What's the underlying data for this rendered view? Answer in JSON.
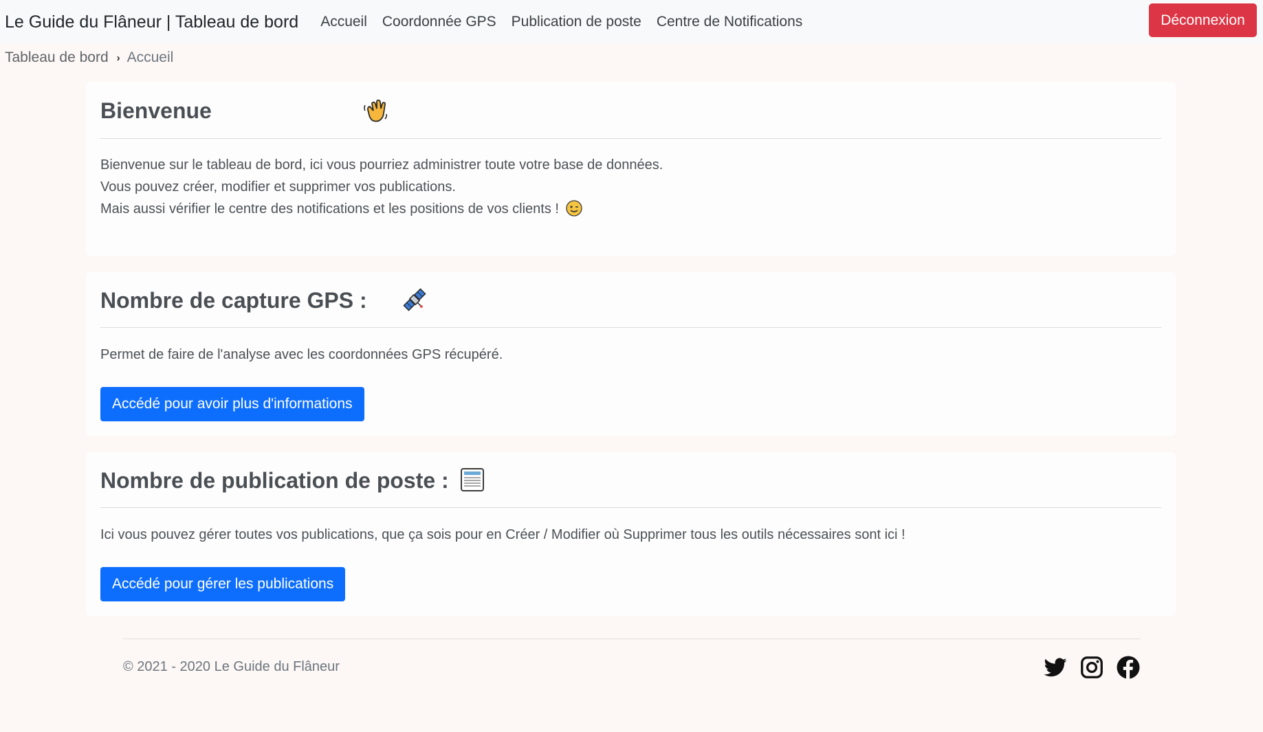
{
  "navbar": {
    "brand": "Le Guide du Flâneur | Tableau de bord",
    "links": [
      "Accueil",
      "Coordonnée GPS",
      "Publication de poste",
      "Centre de Notifications"
    ],
    "logout_label": "Déconnexion"
  },
  "breadcrumb": {
    "root": "Tableau de bord",
    "separator": "›",
    "current": "Accueil"
  },
  "welcome": {
    "title": "Bienvenue",
    "lines": [
      "Bienvenue sur le tableau de bord, ici vous pourriez administrer toute votre base de données.",
      "Vous pouvez créer, modifier et supprimer vos publications.",
      "Mais aussi vérifier le centre des notifications et les positions de vos clients !"
    ],
    "icon": "waving-hand-icon",
    "line_icon": "winking-face-icon"
  },
  "gps": {
    "title": "Nombre de capture GPS :",
    "text": "Permet de faire de l'analyse avec les coordonnées GPS récupéré.",
    "button_label": "Accédé pour avoir plus d'informations",
    "icon": "satellite-icon"
  },
  "posts": {
    "title": "Nombre de publication de poste :",
    "text": "Ici vous pouvez gérer toutes vos publications, que ça sois pour en Créer / Modifier où Supprimer tous les outils nécessaires sont ici !",
    "button_label": "Accédé pour gérer les publications",
    "icon": "newspaper-icon"
  },
  "footer": {
    "copyright": "© 2021 - 2020 Le Guide du Flâneur",
    "social_icons": [
      "twitter-icon",
      "instagram-icon",
      "facebook-icon"
    ]
  },
  "colors": {
    "danger": "#dc3545",
    "primary": "#0d6efd",
    "navbar_bg": "#f8f9fa",
    "page_bg": "#fdf8f6"
  }
}
